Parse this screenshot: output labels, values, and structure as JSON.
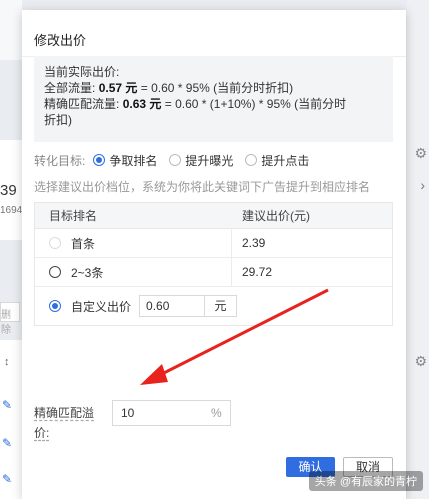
{
  "background": {
    "number": "39",
    "sub_number": "1694",
    "delete_label": "删除"
  },
  "modal": {
    "title": "修改出价",
    "current_price": {
      "heading": "当前实际出价:",
      "all_traffic_prefix": "全部流量:",
      "all_traffic_value": "0.57 元",
      "all_traffic_formula": "= 0.60 * 95% (当前分时折扣)",
      "exact_prefix": "精确匹配流量:",
      "exact_value": "0.63 元",
      "exact_formula_line1": "= 0.60 * (1+10%) * 95% (当前分时",
      "exact_formula_line2": "折扣)"
    },
    "conversion_target": {
      "label": "转化目标:",
      "options": [
        "争取排名",
        "提升曝光",
        "提升点击"
      ],
      "selected": "争取排名"
    },
    "hint": "选择建议出价档位，系统为你将此关键词下广告提升到相应排名",
    "table": {
      "headers": [
        "目标排名",
        "建议出价(元)"
      ],
      "rows": [
        {
          "rank": "首条",
          "price": "2.39"
        },
        {
          "rank": "2~3条",
          "price": "29.72"
        }
      ],
      "custom": {
        "label": "自定义出价",
        "value": "0.60",
        "unit": "元",
        "selected": true
      }
    },
    "exact_premium": {
      "label": "精确匹配溢价:",
      "value": "10",
      "unit": "%"
    },
    "buttons": {
      "ok": "确认",
      "cancel": "取消"
    }
  },
  "watermark": "头条 @有辰家的青柠",
  "colors": {
    "accent": "#2f6de1",
    "annotation_arrow": "#e8231d"
  }
}
